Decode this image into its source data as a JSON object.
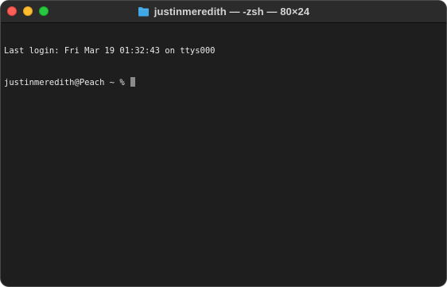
{
  "window": {
    "title": "justinmeredith — -zsh — 80×24",
    "title_icon": "folder-icon",
    "colors": {
      "background": "#1e1e1e",
      "titlebar": "#2b2b2b",
      "text": "#e8e8e8",
      "close": "#fe5f57",
      "minimize": "#febc2e",
      "zoom": "#28c840",
      "folder": "#3ea7e6"
    }
  },
  "terminal": {
    "last_login": "Last login: Fri Mar 19 01:32:43 on ttys000",
    "prompt": "justinmeredith@Peach ~ % "
  }
}
